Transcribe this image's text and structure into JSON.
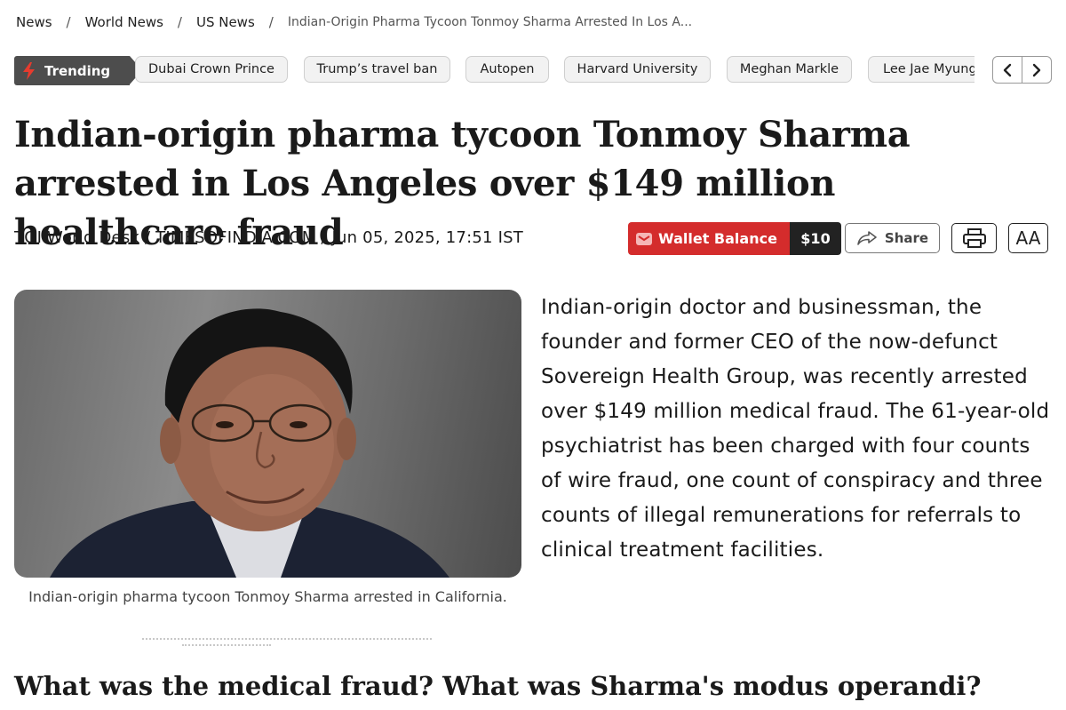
{
  "breadcrumb": {
    "items": [
      "News",
      "World News",
      "US News"
    ],
    "separator": "/",
    "current": "Indian-Origin Pharma Tycoon Tonmoy Sharma Arrested In Los A..."
  },
  "trending": {
    "label": "Trending",
    "icon": "lightning-bolt-icon",
    "accent_color": "#e63b2e",
    "chips": [
      "Dubai Crown Prince",
      "Trump’s travel ban",
      "Autopen",
      "Harvard University",
      "Meghan Markle",
      "Lee Jae Myung"
    ]
  },
  "article": {
    "headline": "Indian-origin pharma tycoon Tonmoy Sharma arrested in Los Angeles over $149 million healthcare fraud",
    "byline": "TOI World Desk / TIMESOFINDIA.COM / Jun 05, 2025, 17:51 IST",
    "caption": "Indian-origin pharma tycoon Tonmoy Sharma arrested in California.",
    "body": "Indian-origin doctor and businessman, the founder and former CEO of the now-defunct Sovereign Health Group, was recently arrested over $149 million medical fraud. The 61-year-old psychiatrist has been charged with four counts of wire fraud, one count of conspiracy and three counts of illegal remunerations for referrals to clinical treatment facilities.",
    "subheading": "What was the medical fraud? What was Sharma's modus operandi?"
  },
  "toolbar": {
    "wallet_label": "Wallet Balance",
    "wallet_amount": "$10",
    "wallet_color": "#d42c2c",
    "share_label": "Share",
    "font_size_label": "AA"
  }
}
